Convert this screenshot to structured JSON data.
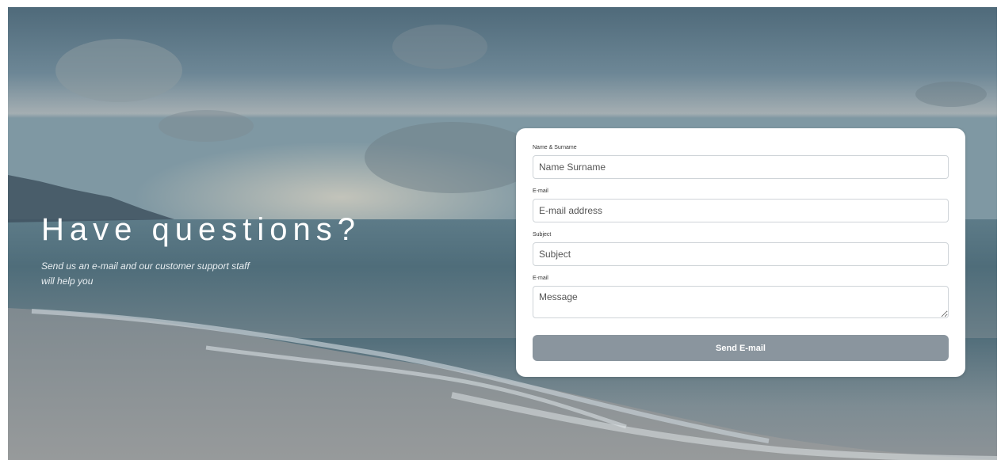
{
  "hero": {
    "title": "Have questions?",
    "subtitle": "Send us an e-mail and our customer support staff will help you"
  },
  "form": {
    "name": {
      "label": "Name & Surname",
      "placeholder": "Name Surname",
      "value": ""
    },
    "email": {
      "label": "E-mail",
      "placeholder": "E-mail address",
      "value": ""
    },
    "subject": {
      "label": "Subject",
      "placeholder": "Subject",
      "value": ""
    },
    "message": {
      "label": "E-mail",
      "placeholder": "Message",
      "value": ""
    },
    "submit_label": "Send E-mail"
  },
  "colors": {
    "button": "#8a959e",
    "card": "#ffffff",
    "overlay": "#56707f"
  },
  "background_image": "beach-sunset-photo"
}
